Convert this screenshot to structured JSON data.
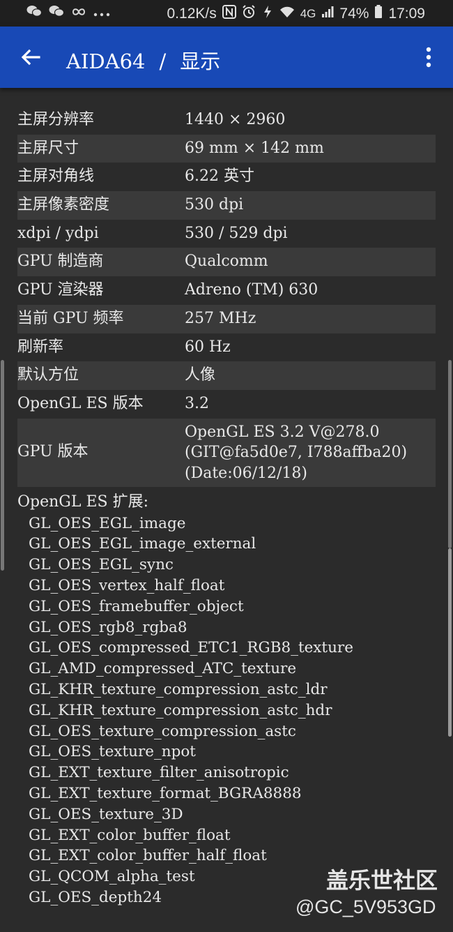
{
  "status_bar": {
    "left_icons": [
      "wechat-icon",
      "wechat-icon",
      "infinity-icon",
      "more-dots-icon"
    ],
    "network_speed": "0.12K/s",
    "network_type": "4G",
    "battery": "74%",
    "time": "17:09"
  },
  "app_bar": {
    "app_name": "AIDA64",
    "separator": "/",
    "section": "显示",
    "color": "#1849b6"
  },
  "rows": [
    {
      "key": "主屏分辨率",
      "value": "1440 × 2960"
    },
    {
      "key": "主屏尺寸",
      "value": "69 mm × 142 mm"
    },
    {
      "key": "主屏对角线",
      "value": "6.22 英寸"
    },
    {
      "key": "主屏像素密度",
      "value": "530 dpi"
    },
    {
      "key": "xdpi / ydpi",
      "value": "530 / 529 dpi"
    },
    {
      "key": "GPU 制造商",
      "value": "Qualcomm"
    },
    {
      "key": "GPU 渲染器",
      "value": "Adreno (TM) 630"
    },
    {
      "key": "当前 GPU 频率",
      "value": "257 MHz"
    },
    {
      "key": "刷新率",
      "value": "60 Hz"
    },
    {
      "key": "默认方位",
      "value": "人像"
    },
    {
      "key": "OpenGL ES 版本",
      "value": "3.2"
    }
  ],
  "gpu_version": {
    "key": "GPU 版本",
    "lines": [
      "OpenGL ES 3.2 V@278.0",
      "(GIT@fa5d0e7, I788affba20)",
      "(Date:06/12/18)"
    ]
  },
  "extensions": {
    "title": "OpenGL ES 扩展:",
    "items": [
      "GL_OES_EGL_image",
      "GL_OES_EGL_image_external",
      "GL_OES_EGL_sync",
      "GL_OES_vertex_half_float",
      "GL_OES_framebuffer_object",
      "GL_OES_rgb8_rgba8",
      "GL_OES_compressed_ETC1_RGB8_texture",
      "GL_AMD_compressed_ATC_texture",
      "GL_KHR_texture_compression_astc_ldr",
      "GL_KHR_texture_compression_astc_hdr",
      "GL_OES_texture_compression_astc",
      "GL_OES_texture_npot",
      "GL_EXT_texture_filter_anisotropic",
      "GL_EXT_texture_format_BGRA8888",
      "GL_OES_texture_3D",
      "GL_EXT_color_buffer_float",
      "GL_EXT_color_buffer_half_float",
      "GL_QCOM_alpha_test",
      "GL_OES_depth24"
    ]
  },
  "watermark": {
    "site": "盖乐世社区",
    "handle": "@GC_5V953GD"
  }
}
